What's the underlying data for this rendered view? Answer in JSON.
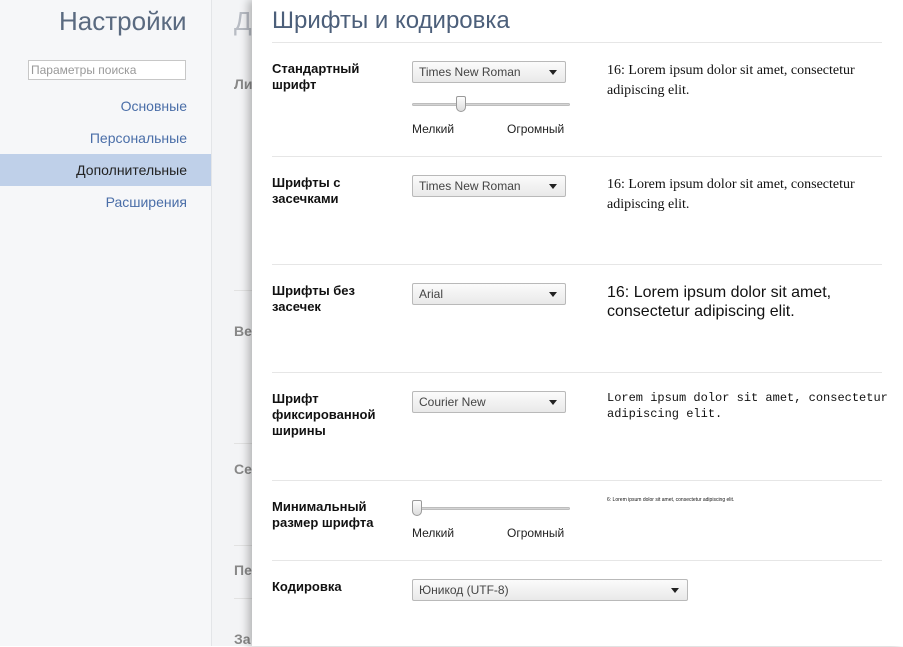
{
  "sidebar": {
    "title": "Настройки",
    "search_placeholder": "Параметры поиска",
    "items": [
      {
        "label": "Основные"
      },
      {
        "label": "Персональные"
      },
      {
        "label": "Дополнительные"
      },
      {
        "label": "Расширения"
      }
    ]
  },
  "background": {
    "heading": "Д",
    "labels": [
      "Ли",
      "Ве",
      "Се",
      "Пе",
      "За"
    ]
  },
  "overlay": {
    "title": "Шрифты и кодировка",
    "standard": {
      "label": "Стандартный шрифт",
      "font": "Times New Roman",
      "slider_min": "Мелкий",
      "slider_max": "Огромный",
      "slider_value": 0.3,
      "preview": "16: Lorem ipsum dolor sit amet, consectetur adipiscing elit."
    },
    "serif": {
      "label": "Шрифты с засечками",
      "font": "Times New Roman",
      "preview": "16: Lorem ipsum dolor sit amet, consectetur adipiscing elit."
    },
    "sans": {
      "label": "Шрифты без засечек",
      "font": "Arial",
      "preview": "16: Lorem ipsum dolor sit amet, consectetur adipiscing elit."
    },
    "fixed": {
      "label": "Шрифт фиксированной ширины",
      "font": "Courier New",
      "preview": "Lorem ipsum dolor sit amet, consectetur adipiscing elit."
    },
    "minimum": {
      "label": "Минимальный размер шрифта",
      "slider_min": "Мелкий",
      "slider_max": "Огромный",
      "slider_value": 0.0,
      "preview": "6: Lorem ipsum dolor sit amet, consectetur adipiscing elit."
    },
    "encoding": {
      "label": "Кодировка",
      "value": "Юникод (UTF-8)"
    }
  }
}
